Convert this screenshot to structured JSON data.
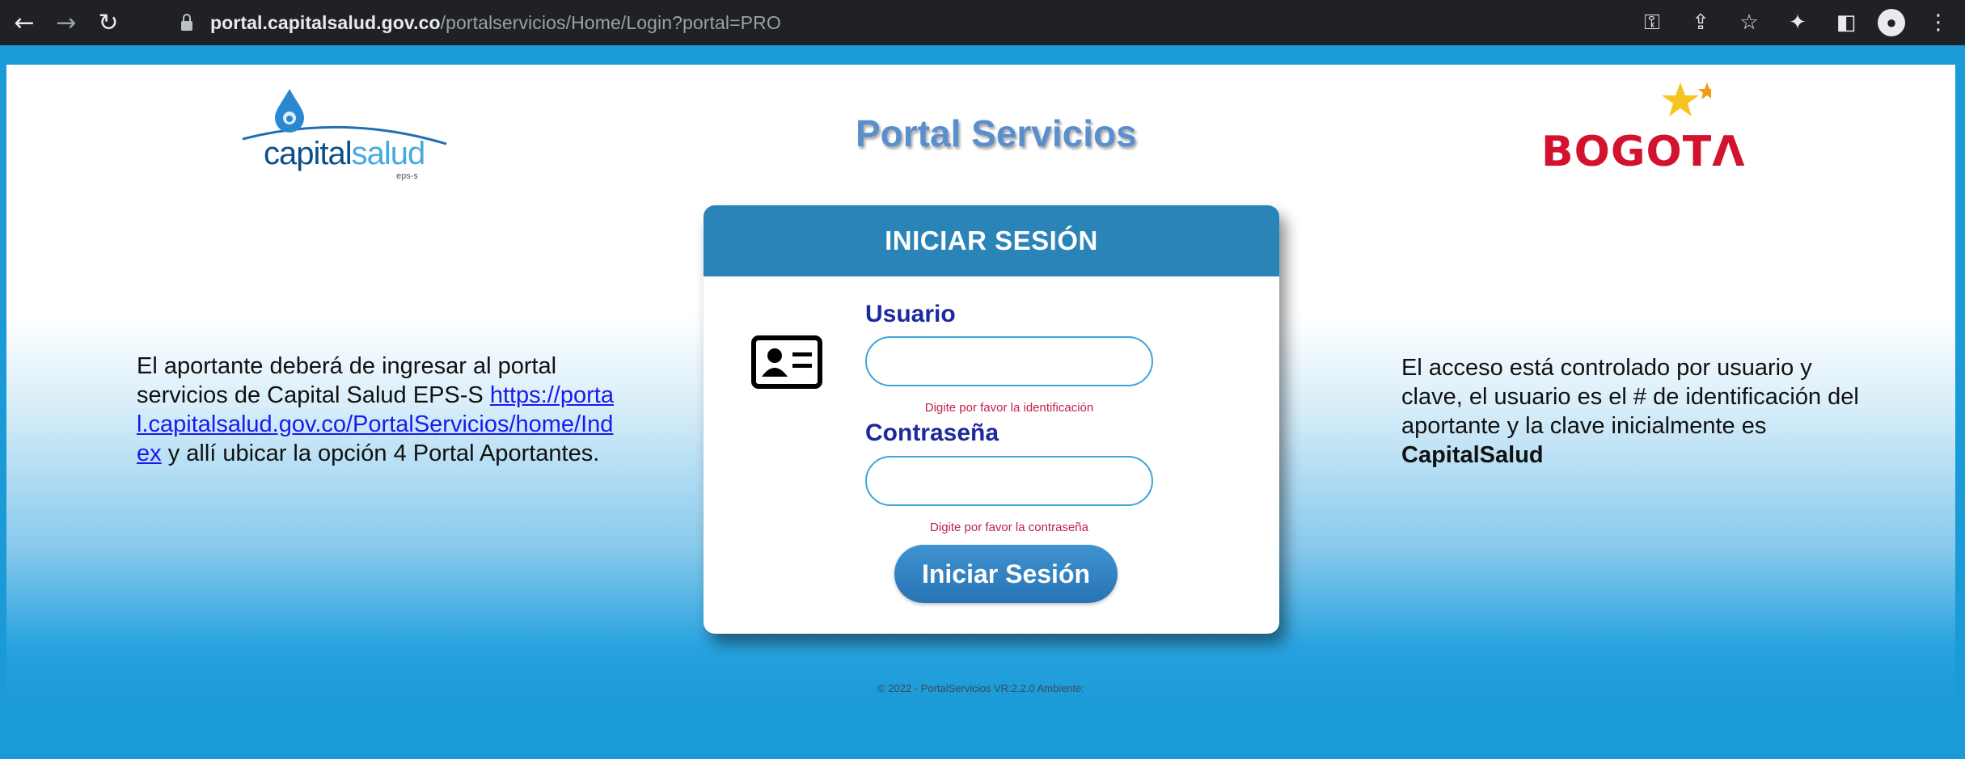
{
  "browser": {
    "url_host": "portal.capitalsalud.gov.co",
    "url_path": "/portalservicios/Home/Login?portal=PRO"
  },
  "header": {
    "logo_left_word1": "capital",
    "logo_left_word2": "salud",
    "logo_left_sub": "eps-s",
    "title": "Portal Servicios",
    "logo_right": "BOGOTΛ"
  },
  "left_note": {
    "before": "El aportante deberá de ingresar al portal servicios de Capital Salud EPS-S ",
    "link": "https://portal.capitalsalud.gov.co/PortalServicios/home/Index",
    "after": " y allí ubicar la opción 4 Portal Aportantes."
  },
  "right_note": {
    "before": "El acceso está controlado por usuario y clave, el usuario es el # de identificación del aportante y la clave inicialmente es ",
    "bold": "CapitalSalud"
  },
  "login": {
    "heading": "INICIAR SESIÓN",
    "user_label": "Usuario",
    "user_value": "",
    "user_hint": "Digite por favor la identificación",
    "pass_label": "Contraseña",
    "pass_value": "",
    "pass_hint": "Digite por favor la contraseña",
    "submit": "Iniciar Sesión"
  },
  "footer": "© 2022 - PortalServicios VR:2.2.0 Ambiente:"
}
